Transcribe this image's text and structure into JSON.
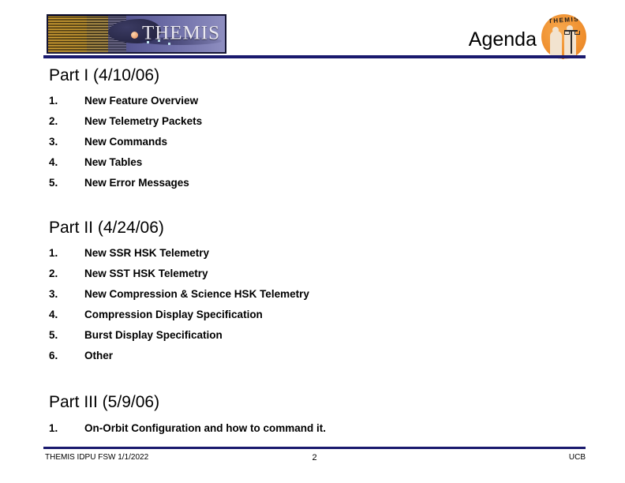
{
  "header": {
    "banner_wordmark": "THEMIS",
    "banner_alt": "themis-magnetosphere-banner",
    "title": "Agenda",
    "patch_text": "THEMIS"
  },
  "parts": [
    {
      "heading": "Part I (4/10/06)",
      "items": [
        {
          "num": "1.",
          "label": "New Feature Overview"
        },
        {
          "num": "2.",
          "label": "New Telemetry Packets"
        },
        {
          "num": "3.",
          "label": "New Commands"
        },
        {
          "num": "4.",
          "label": "New Tables"
        },
        {
          "num": "5.",
          "label": "New Error Messages"
        }
      ]
    },
    {
      "heading": "Part II (4/24/06)",
      "items": [
        {
          "num": "1.",
          "label": "New SSR HSK Telemetry"
        },
        {
          "num": "2.",
          "label": "New SST HSK Telemetry"
        },
        {
          "num": "3.",
          "label": "New Compression & Science HSK Telemetry"
        },
        {
          "num": "4.",
          "label": "Compression Display Specification"
        },
        {
          "num": "5.",
          "label": "Burst Display Specification"
        },
        {
          "num": "6.",
          "label": "Other"
        }
      ]
    },
    {
      "heading": "Part III (5/9/06)",
      "items": [
        {
          "num": "1.",
          "label": "On-Orbit Configuration and how to command it."
        }
      ]
    }
  ],
  "footer": {
    "left": "THEMIS IDPU FSW 1/1/2022",
    "page": "2",
    "right": "UCB"
  },
  "colors": {
    "rule_navy": "#1a1a6e",
    "patch_orange": "#ef8f2e",
    "banner_purple": "#5a5a96",
    "text_black": "#000000"
  }
}
